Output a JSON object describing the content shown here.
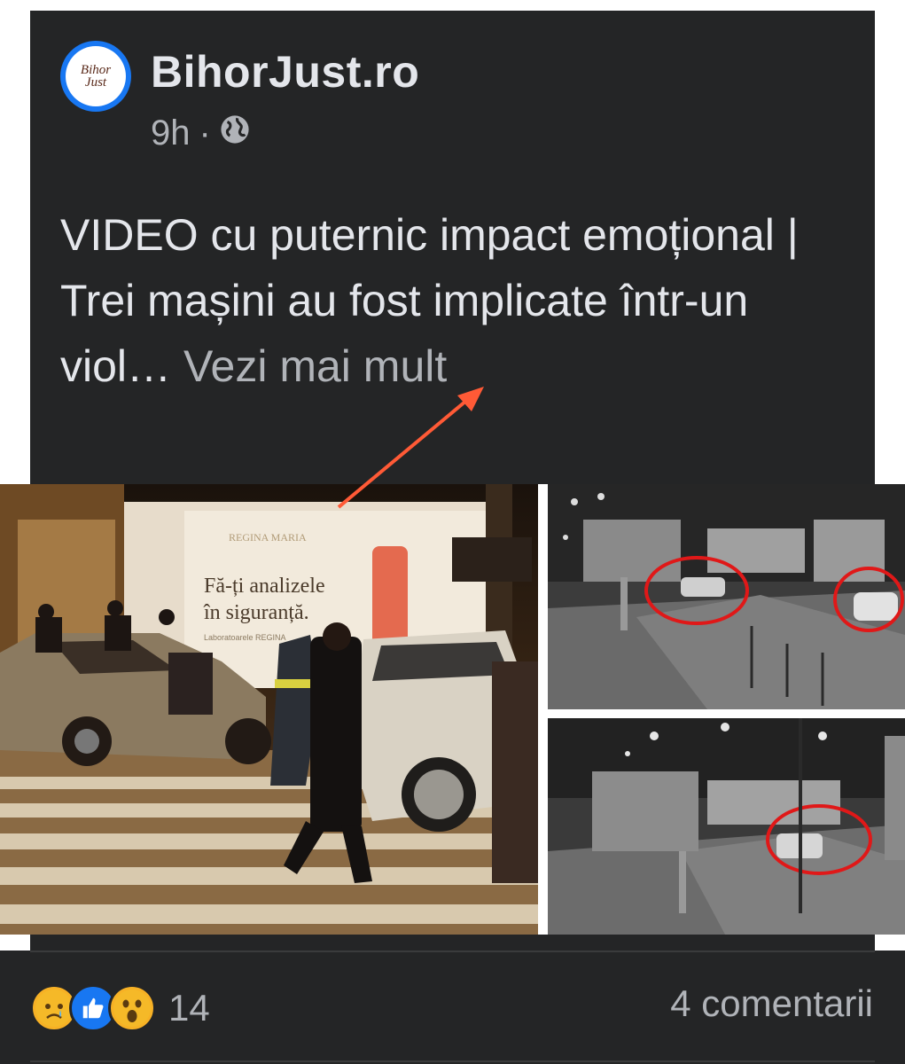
{
  "post": {
    "page_name": "BihorJust.ro",
    "avatar_text_line1": "Bihor",
    "avatar_text_line2": "Just",
    "time": "9h",
    "separator": "·",
    "privacy_icon": "globe-icon",
    "text": "VIDEO cu puternic impact emoțional | Trei mașini au fost implicate într-un viol…",
    "see_more": "Vezi mai mult",
    "photo_left": {
      "sign_brand": "REGINA MARIA",
      "sign_line1": "Fă-ți analizele",
      "sign_line2": "în siguranță.",
      "sign_small": "Laboratoarele REGINA"
    }
  },
  "footer": {
    "reaction_icons": [
      "sad-emoji-icon",
      "like-icon",
      "wow-emoji-icon"
    ],
    "reaction_count": "14",
    "comments": "4 comentarii"
  },
  "colors": {
    "card_bg": "#242526",
    "text_primary": "#e4e6eb",
    "text_secondary": "#b0b3b8",
    "accent": "#1877f2",
    "arrow": "#ff5a36",
    "circle": "#e01818"
  }
}
